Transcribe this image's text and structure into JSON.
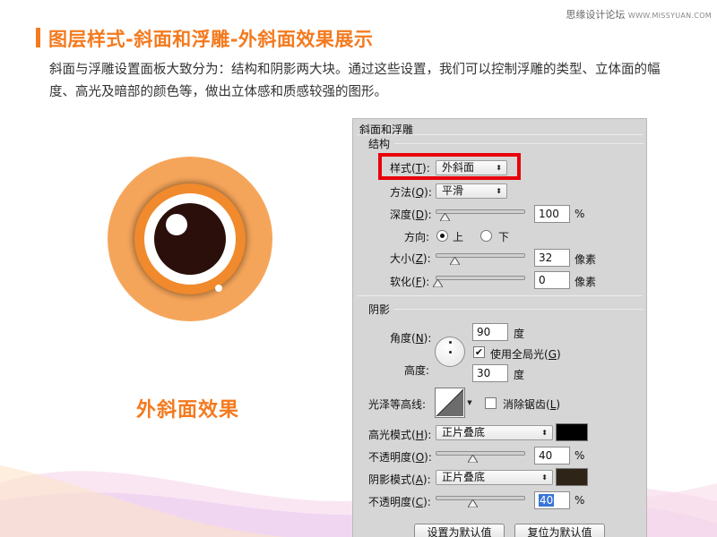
{
  "watermark": {
    "text": "思缘设计论坛",
    "site": "WWW.MISSYUAN.COM"
  },
  "page_title": "图层样式-斜面和浮雕-外斜面效果展示",
  "description": "斜面与浮雕设置面板大致分为：结构和阴影两大块。通过这些设置，我们可以控制浮雕的类型、立体面的幅度、高光及暗部的颜色等，做出立体感和质感较强的图形。",
  "illustration": {
    "caption": "外斜面效果"
  },
  "panel": {
    "title": "斜面和浮雕",
    "structure": {
      "title": "结构",
      "style": {
        "label": "样式(",
        "key": "T",
        "suffix": "):",
        "value": "外斜面"
      },
      "technique": {
        "label": "方法(",
        "key": "Q",
        "suffix": "):",
        "value": "平滑"
      },
      "depth": {
        "label": "深度(",
        "key": "D",
        "suffix": "):",
        "value": "100",
        "unit": "%",
        "level": 0.0
      },
      "direction": {
        "label": "方向:",
        "up": "上",
        "down": "下",
        "selected": "up"
      },
      "size": {
        "label": "大小(",
        "key": "Z",
        "suffix": "):",
        "value": "32",
        "unit": "像素",
        "level": 0.13
      },
      "soften": {
        "label": "软化(",
        "key": "F",
        "suffix": "):",
        "value": "0",
        "unit": "像素",
        "level": 0.0
      }
    },
    "shading": {
      "title": "阴影",
      "angle": {
        "label": "角度(",
        "key": "N",
        "suffix": "):",
        "value": "90",
        "unit": "度"
      },
      "global_light": {
        "label": "使用全局光(",
        "key": "G",
        "suffix": ")",
        "checked": true
      },
      "altitude": {
        "label": "高度:",
        "value": "30",
        "unit": "度"
      },
      "gloss_contour": {
        "label": "光泽等高线:"
      },
      "anti_aliased": {
        "label": "消除锯齿(",
        "key": "L",
        "suffix": ")",
        "checked": false
      },
      "highlight_mode": {
        "label": "高光模式(",
        "key": "H",
        "suffix": "):",
        "value": "正片叠底",
        "color": "#000000"
      },
      "highlight_opacity": {
        "label": "不透明度(",
        "key": "O",
        "suffix": "):",
        "value": "40",
        "unit": "%",
        "level": 0.4
      },
      "shadow_mode": {
        "label": "阴影模式(",
        "key": "A",
        "suffix": "):",
        "value": "正片叠底",
        "color": "#2e2418"
      },
      "shadow_opacity": {
        "label": "不透明度(",
        "key": "C",
        "suffix": "):",
        "value": "40",
        "unit": "%",
        "level": 0.4
      }
    },
    "buttons": {
      "make_default": "设置为默认值",
      "reset_default": "复位为默认值"
    }
  },
  "colors": {
    "accent": "#f47a1f",
    "highlight_border": "#e8000c",
    "eye_orange": "#f5a55a",
    "iris": "#2a0f0b"
  }
}
